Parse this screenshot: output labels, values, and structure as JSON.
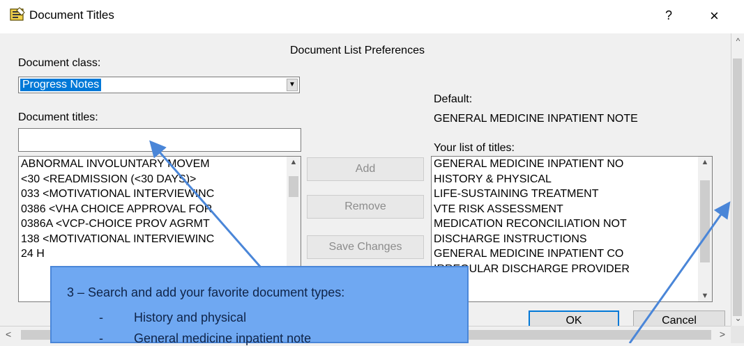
{
  "window": {
    "title": "Document Titles",
    "help_label": "?",
    "close_label": "×"
  },
  "dialog": {
    "heading": "Document List Preferences",
    "document_class_label": "Document class:",
    "document_class_value": "Progress Notes",
    "document_titles_label": "Document titles:",
    "search_value": "",
    "titles_list": [
      " ABNORMAL INVOLUNTARY MOVEM",
      "<30  <READMISSION (<30 DAYS)>",
      "033  <MOTIVATIONAL INTERVIEWINC",
      "0386  <VHA CHOICE APPROVAL FOR",
      "0386A  <VCP-CHOICE PROV AGRMT",
      "138  <MOTIVATIONAL INTERVIEWINC",
      "24 H"
    ],
    "default_label": "Default:",
    "default_value": "GENERAL MEDICINE INPATIENT NOTE",
    "your_list_label": "Your list of titles:",
    "your_list": [
      "GENERAL MEDICINE INPATIENT NO",
      "HISTORY & PHYSICAL",
      "LIFE-SUSTAINING TREATMENT",
      "VTE RISK ASSESSMENT",
      "MEDICATION RECONCILIATION NOT",
      "DISCHARGE INSTRUCTIONS",
      "GENERAL MEDICINE INPATIENT CO",
      "IRREGULAR DISCHARGE PROVIDER"
    ],
    "buttons": {
      "add": "Add",
      "remove": "Remove",
      "save_changes": "Save Changes",
      "ok": "OK",
      "cancel": "Cancel"
    }
  },
  "callout": {
    "title": "3 – Search and add your favorite document types:",
    "items": [
      {
        "bullet": "-",
        "text": "History and physical"
      },
      {
        "bullet": "-",
        "text": "General medicine inpatient note"
      }
    ]
  },
  "colors": {
    "selection": "#0078d7",
    "callout_fill": "#6fa8f2",
    "callout_text": "#0f2448",
    "arrow": "#4a86d8"
  }
}
